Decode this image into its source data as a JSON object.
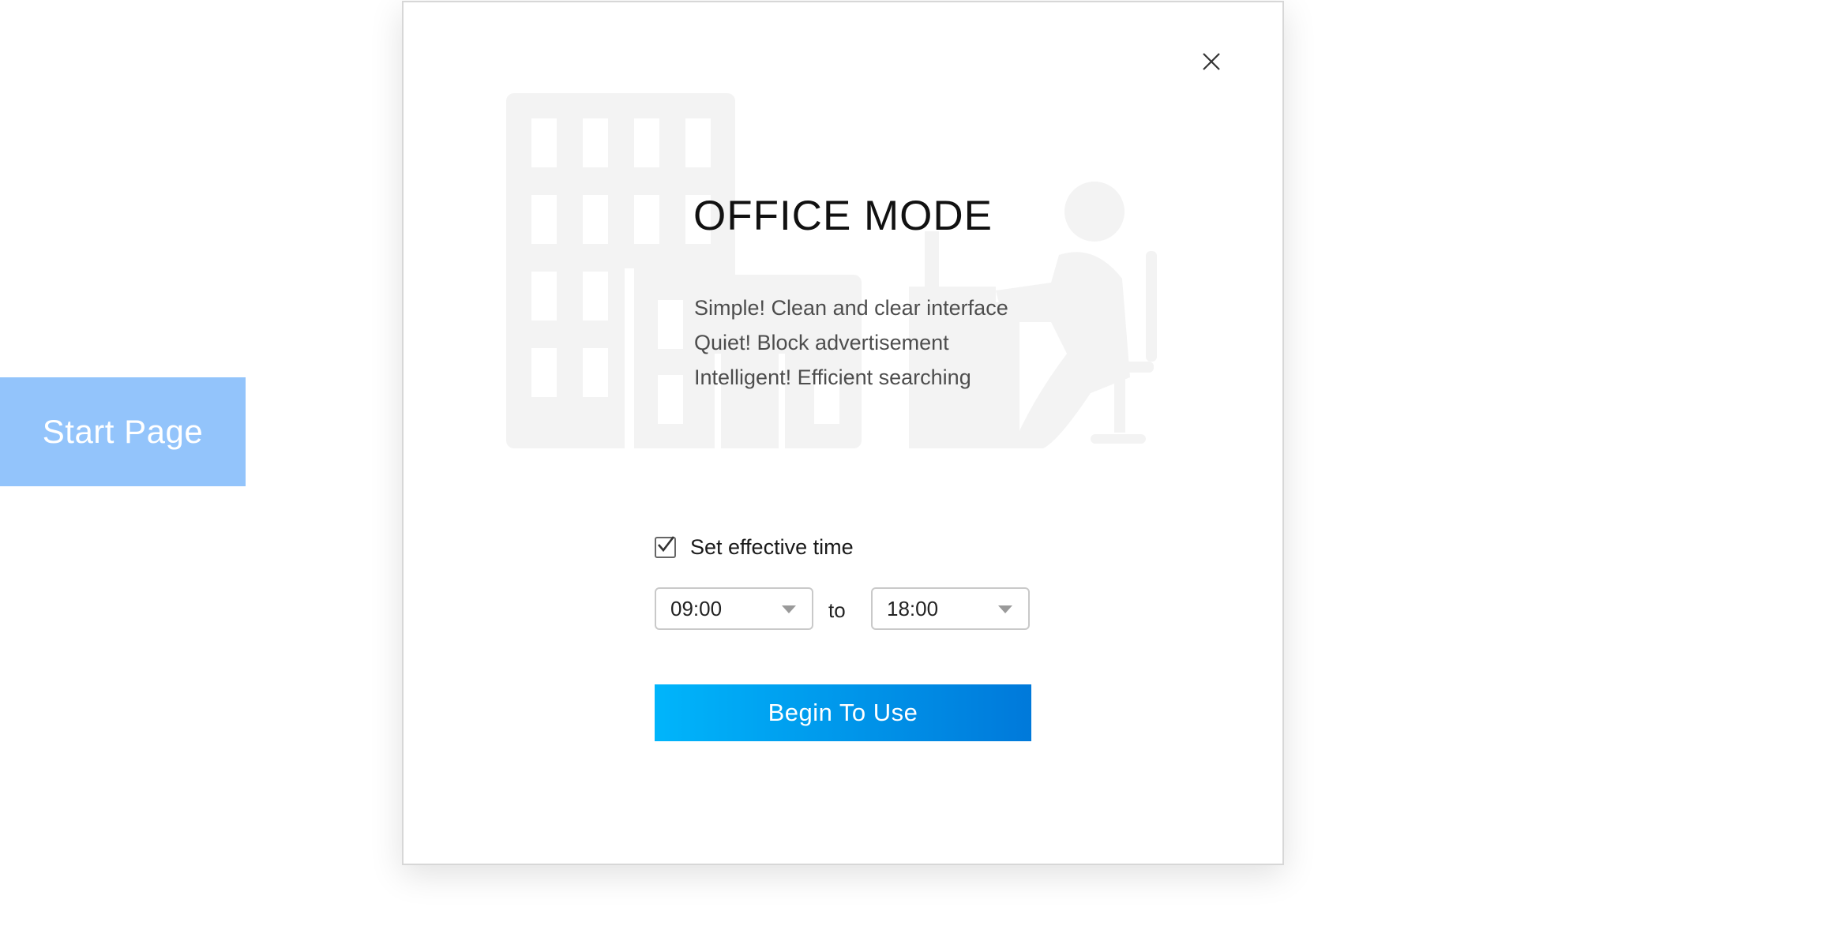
{
  "sidebar": {
    "start_page_label": "Start Page"
  },
  "dialog": {
    "title": "OFFICE MODE",
    "features": [
      "Simple! Clean and clear interface",
      "Quiet! Block advertisement",
      "Intelligent! Efficient searching"
    ],
    "effective_time": {
      "label": "Set effective time",
      "checked": true,
      "from_value": "09:00",
      "to_label": "to",
      "to_value": "18:00"
    },
    "primary_button_label": "Begin To Use",
    "close_icon": "close-icon"
  },
  "colors": {
    "start_page_bg": "#93c4fb",
    "button_gradient_start": "#00b5fb",
    "button_gradient_end": "#0079da",
    "illustration": "#f3f3f3"
  }
}
